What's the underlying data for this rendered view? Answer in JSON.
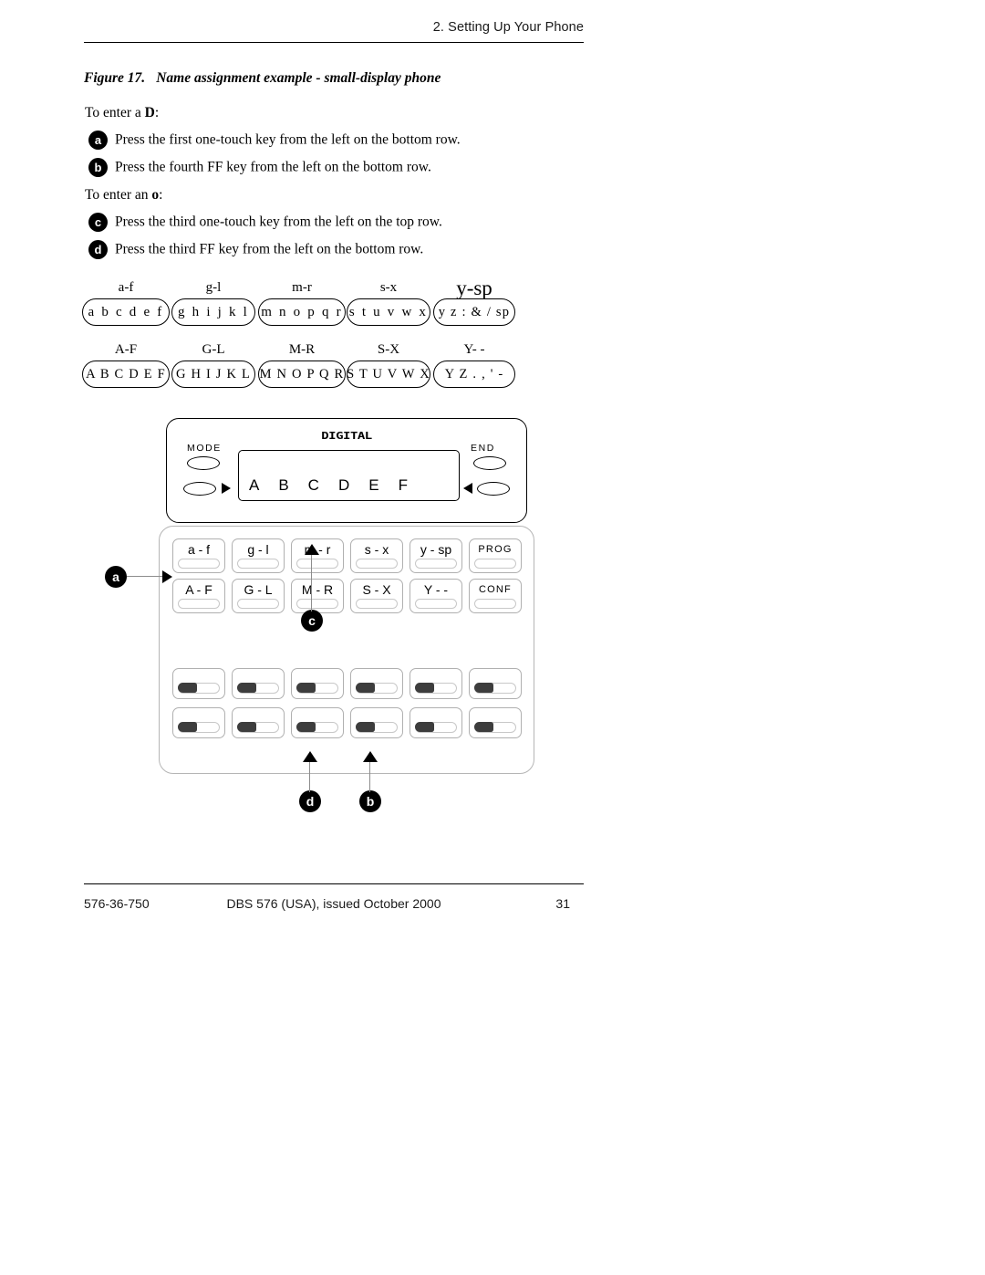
{
  "header": {
    "chapter": "2. Setting Up Your Phone"
  },
  "figure": {
    "number": "Figure 17.",
    "title": "Name assignment example - small-display phone"
  },
  "instructions": {
    "lead_d_prefix": "To enter a ",
    "lead_d_char": "D",
    "lead_d_suffix": ":",
    "lead_o_prefix": "To enter an ",
    "lead_o_char": "o",
    "lead_o_suffix": ":",
    "steps": [
      {
        "marker": "a",
        "text": "Press the first one-touch key from the left on the bottom row."
      },
      {
        "marker": "b",
        "text": "Press the fourth FF key from the left on the bottom row."
      },
      {
        "marker": "c",
        "text": "Press the third one-touch key from the left on the top row."
      },
      {
        "marker": "d",
        "text": "Press the third FF key from the left on the bottom row."
      }
    ]
  },
  "alphabet_chart": {
    "lowercase_row": [
      {
        "label": "a-f",
        "letters": "a b c d e f"
      },
      {
        "label": "g-l",
        "letters": "g h i j k l"
      },
      {
        "label": "m-r",
        "letters": "m n o p q r"
      },
      {
        "label": "s-x",
        "letters": "s t u v w x"
      },
      {
        "label": "y-sp",
        "letters": "y z : & / sp"
      }
    ],
    "uppercase_row": [
      {
        "label": "A-F",
        "letters": "A B C D E F"
      },
      {
        "label": "G-L",
        "letters": "G H I J K L"
      },
      {
        "label": "M-R",
        "letters": "M N O P Q R"
      },
      {
        "label": "S-X",
        "letters": "S T U V W X"
      },
      {
        "label": "Y- -",
        "letters": "Y Z . , ' -"
      }
    ]
  },
  "phone": {
    "brand": "DIGITAL",
    "mode_label": "MODE",
    "end_label": "END",
    "display_text": "ABCDEF",
    "onetouch_top_row": [
      "a - f",
      "g - l",
      "m - r",
      "s - x",
      "y - sp",
      "PROG"
    ],
    "onetouch_bottom_row": [
      "A - F",
      "G - L",
      "M - R",
      "S - X",
      "Y - -",
      "CONF"
    ],
    "callouts": {
      "a": "a",
      "b": "b",
      "c": "c",
      "d": "d"
    }
  },
  "footer": {
    "doc_number": "576-36-750",
    "center": "DBS 576 (USA), issued October 2000",
    "page": "31"
  }
}
